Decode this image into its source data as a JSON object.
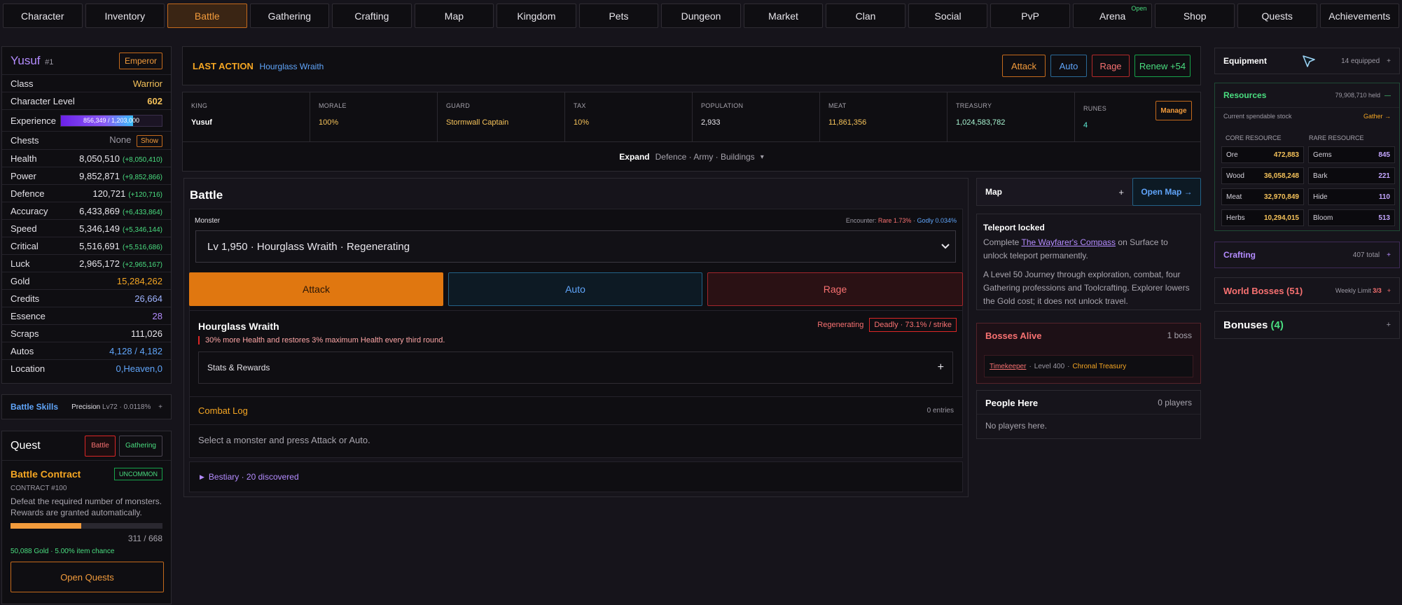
{
  "nav": {
    "tabs": [
      "Character",
      "Inventory",
      "Battle",
      "Gathering",
      "Crafting",
      "Map",
      "Kingdom",
      "Pets",
      "Dungeon",
      "Market",
      "Clan",
      "Social",
      "PvP",
      "Arena",
      "Shop",
      "Quests",
      "Achievements"
    ],
    "active": "Battle",
    "arena_badge": "Open"
  },
  "player": {
    "name": "Yusuf",
    "rank": "#1",
    "title": "Emperor",
    "stats": [
      {
        "label": "Class",
        "value": "Warrior",
        "color": "#f5c25a"
      },
      {
        "label": "Character Level",
        "value": "602",
        "color": "#f5c25a"
      }
    ],
    "experience": {
      "label": "Experience",
      "text": "856,349 / 1,203,000",
      "fraction": 0.712
    },
    "chests": {
      "label": "Chests",
      "value": "None",
      "button": "Show"
    },
    "combat": [
      {
        "label": "Health",
        "value": "8,050,510",
        "inc": "(+8,050,410)"
      },
      {
        "label": "Power",
        "value": "9,852,871",
        "inc": "(+9,852,866)"
      },
      {
        "label": "Defence",
        "value": "120,721",
        "inc": "(+120,716)"
      },
      {
        "label": "Accuracy",
        "value": "6,433,869",
        "inc": "(+6,433,864)"
      },
      {
        "label": "Speed",
        "value": "5,346,149",
        "inc": "(+5,346,144)"
      },
      {
        "label": "Critical",
        "value": "5,516,691",
        "inc": "(+5,516,686)"
      },
      {
        "label": "Luck",
        "value": "2,965,172",
        "inc": "(+2,965,167)"
      }
    ],
    "currency": [
      {
        "label": "Gold",
        "value": "15,284,262",
        "color": "#f5a623"
      },
      {
        "label": "Credits",
        "value": "26,664",
        "color": "#9fb4ff"
      },
      {
        "label": "Essence",
        "value": "28",
        "color": "#b48cff"
      },
      {
        "label": "Scraps",
        "value": "111,026",
        "color": "#e8e6ec"
      },
      {
        "label": "Autos",
        "value": "4,128 / 4,182",
        "color": "#60a5fa"
      },
      {
        "label": "Location",
        "value": "0,Heaven,0",
        "color": "#60a5fa"
      }
    ]
  },
  "battle_skills": {
    "label": "Battle Skills",
    "skill": "Precision",
    "level": "Lv72",
    "pct": "0.0118%",
    "toggle": "+"
  },
  "quest": {
    "title": "Quest",
    "filters": [
      "Battle",
      "Gathering"
    ],
    "contract": "Battle Contract",
    "rarity": "UNCOMMON",
    "number": "CONTRACT #100",
    "desc": "Defeat the required number of monsters. Rewards are granted automatically.",
    "progress_text": "311 / 668",
    "progress_fraction": 0.466,
    "reward": "50,088 Gold · 5.00% item chance",
    "open_button": "Open Quests"
  },
  "last_action": {
    "label": "LAST ACTION",
    "value": "Hourglass Wraith",
    "buttons": [
      "Attack",
      "Auto",
      "Rage",
      "Renew +54"
    ]
  },
  "kingdom": {
    "cells": [
      {
        "k": "KING",
        "v": "Yusuf",
        "color": "#ffffff"
      },
      {
        "k": "MORALE",
        "v": "100%",
        "color": "#f5c25a"
      },
      {
        "k": "GUARD",
        "v": "Stormwall Captain",
        "color": "#f5c25a"
      },
      {
        "k": "TAX",
        "v": "10%",
        "color": "#f5c25a"
      },
      {
        "k": "POPULATION",
        "v": "2,933",
        "color": "#e8e6ec"
      },
      {
        "k": "MEAT",
        "v": "11,861,356",
        "color": "#f5c25a"
      },
      {
        "k": "TREASURY",
        "v": "1,024,583,782",
        "color": "#a7f3d0"
      },
      {
        "k": "RUNES",
        "v": "4",
        "color": "#5eead4"
      }
    ],
    "manage": "Manage",
    "expand_label": "Expand",
    "expand_items": "Defence · Army · Buildings",
    "expand_chevron": "▾"
  },
  "battle": {
    "title": "Battle",
    "monster_label": "Monster",
    "encounter_label": "Encounter:",
    "encounter_rare": "Rare 1.73%",
    "encounter_godly": "Godly 0.034%",
    "selected": "Lv 1,950 · Hourglass Wraith · Regenerating",
    "actions": [
      "Attack",
      "Auto",
      "Rage"
    ],
    "monster_name": "Hourglass Wraith",
    "trait": "Regenerating",
    "danger": "Deadly · 73.1% / strike",
    "trait_desc": "30% more Health and restores 3% maximum Health every third round.",
    "stats_rewards": "Stats & Rewards",
    "combat_log": "Combat Log",
    "combat_log_count": "0 entries",
    "combat_log_empty": "Select a monster and press Attack or Auto.",
    "bestiary": "Bestiary · 20 discovered"
  },
  "map": {
    "label": "Map",
    "toggle": "+",
    "open_button": "Open Map →",
    "teleport_title": "Teleport locked",
    "teleport_pre": "Complete",
    "teleport_link": "The Wayfarer's Compass",
    "teleport_post": "on Surface to unlock teleport permanently.",
    "journey": "A Level 50 Journey through exploration, combat, four Gathering professions and Toolcrafting. Explorer lowers the Gold cost; it does not unlock travel."
  },
  "bosses": {
    "title": "Bosses Alive",
    "count": "1 boss",
    "boss_name": "Timekeeper",
    "boss_level": "Level 400",
    "boss_location": "Chronal Treasury"
  },
  "people": {
    "title": "People Here",
    "count": "0 players",
    "empty": "No players here."
  },
  "equipment": {
    "title": "Equipment",
    "count": "14 equipped",
    "toggle": "+"
  },
  "resources": {
    "title": "Resources",
    "held": "79,908,710 held",
    "toggle": "—",
    "stock_label": "Current spendable stock",
    "gather": "Gather →",
    "core_header": "CORE RESOURCE",
    "rare_header": "RARE RESOURCE",
    "core": [
      {
        "name": "Ore",
        "value": "472,883"
      },
      {
        "name": "Wood",
        "value": "36,058,248"
      },
      {
        "name": "Meat",
        "value": "32,970,849"
      },
      {
        "name": "Herbs",
        "value": "10,294,015"
      }
    ],
    "rare": [
      {
        "name": "Gems",
        "value": "845"
      },
      {
        "name": "Bark",
        "value": "221"
      },
      {
        "name": "Hide",
        "value": "110"
      },
      {
        "name": "Bloom",
        "value": "513"
      }
    ]
  },
  "crafting": {
    "title": "Crafting",
    "total": "407 total",
    "toggle": "+"
  },
  "world_bosses": {
    "title": "World Bosses (51)",
    "limit_label": "Weekly Limit",
    "limit": "3/3",
    "toggle": "+"
  },
  "bonuses": {
    "title": "Bonuses",
    "count": "(4)",
    "toggle": "+"
  },
  "colors": {
    "accent": "#f29b3c",
    "gold": "#f5c25a",
    "green": "#4ade80",
    "blue": "#60a5fa",
    "red": "#f87171",
    "purple": "#b48cff",
    "bg": "#16141b",
    "panel": "#0f0e12"
  }
}
